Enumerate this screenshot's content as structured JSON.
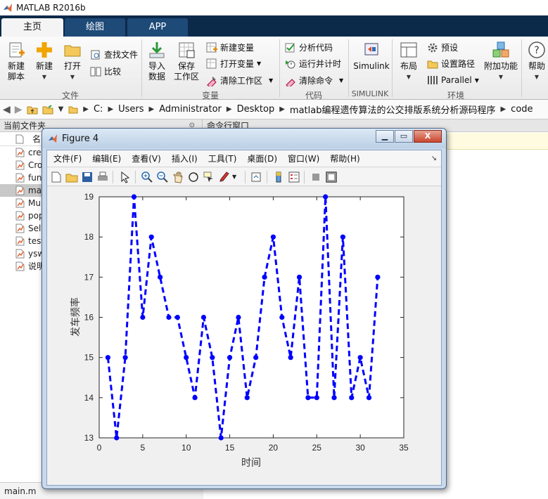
{
  "app": {
    "title": "MATLAB R2016b"
  },
  "tabs": [
    {
      "label": "主页",
      "active": true
    },
    {
      "label": "绘图",
      "active": false
    },
    {
      "label": "APP",
      "active": false
    }
  ],
  "ribbon": {
    "new_script": "新建\n脚本",
    "new": "新建",
    "open": "打开",
    "find_files": "查找文件",
    "compare": "比较",
    "import_data": "导入\n数据",
    "save_workspace": "保存\n工作区",
    "new_variable": "新建变量",
    "open_variable": "打开变量",
    "clear_workspace": "清除工作区",
    "analyze_code": "分析代码",
    "run_and_time": "运行并计时",
    "clear_commands": "清除命令",
    "simulink": "Simulink",
    "layout": "布局",
    "preferences": "预设",
    "set_path": "设置路径",
    "parallel": "Parallel",
    "addons": "附加功能",
    "help": "帮助",
    "groups": {
      "file": "文件",
      "variable": "变量",
      "code": "代码",
      "simulink": "SIMULINK",
      "environment": "环境"
    }
  },
  "address": {
    "crumbs": [
      "C:",
      "Users",
      "Administrator",
      "Desktop",
      "matlab编程遗传算法的公交排版系统分析源码程序",
      "code"
    ]
  },
  "file_panel": {
    "title": "当前文件夹",
    "column": "名",
    "items": [
      {
        "name": "cre",
        "selected": false
      },
      {
        "name": "Cro",
        "selected": false
      },
      {
        "name": "fun",
        "selected": false
      },
      {
        "name": "ma",
        "selected": true
      },
      {
        "name": "Mu",
        "selected": false
      },
      {
        "name": "pop",
        "selected": false
      },
      {
        "name": "Sel",
        "selected": false
      },
      {
        "name": "test",
        "selected": false
      },
      {
        "name": "ysw",
        "selected": false
      },
      {
        "name": "说明",
        "selected": false
      }
    ],
    "status_file": "main.m"
  },
  "command_panel": {
    "title": "命令行窗口"
  },
  "figure": {
    "title": "Figure 4",
    "menus": [
      "文件(F)",
      "编辑(E)",
      "查看(V)",
      "插入(I)",
      "工具(T)",
      "桌面(D)",
      "窗口(W)",
      "帮助(H)"
    ],
    "close_label": "X"
  },
  "chart_data": {
    "type": "line",
    "x": [
      1,
      2,
      3,
      4,
      5,
      6,
      7,
      8,
      9,
      10,
      11,
      12,
      13,
      14,
      15,
      16,
      17,
      18,
      19,
      20,
      21,
      22,
      23,
      24,
      25,
      26,
      27,
      28,
      29,
      30,
      31,
      32
    ],
    "y": [
      15,
      13,
      15,
      19,
      16,
      18,
      17,
      16,
      16,
      15,
      14,
      16,
      15,
      13,
      15,
      16,
      14,
      15,
      17,
      18,
      16,
      15,
      17,
      14,
      14,
      19,
      14,
      18,
      14,
      15,
      14,
      17
    ],
    "xlabel": "时间",
    "ylabel": "发车频率",
    "xlim": [
      0,
      35
    ],
    "ylim": [
      13,
      19
    ],
    "xticks": [
      0,
      5,
      10,
      15,
      20,
      25,
      30,
      35
    ],
    "yticks": [
      13,
      14,
      15,
      16,
      17,
      18,
      19
    ],
    "line_style": "dashed",
    "marker": "filled-circle",
    "color": "#0000ff",
    "grid": false
  }
}
